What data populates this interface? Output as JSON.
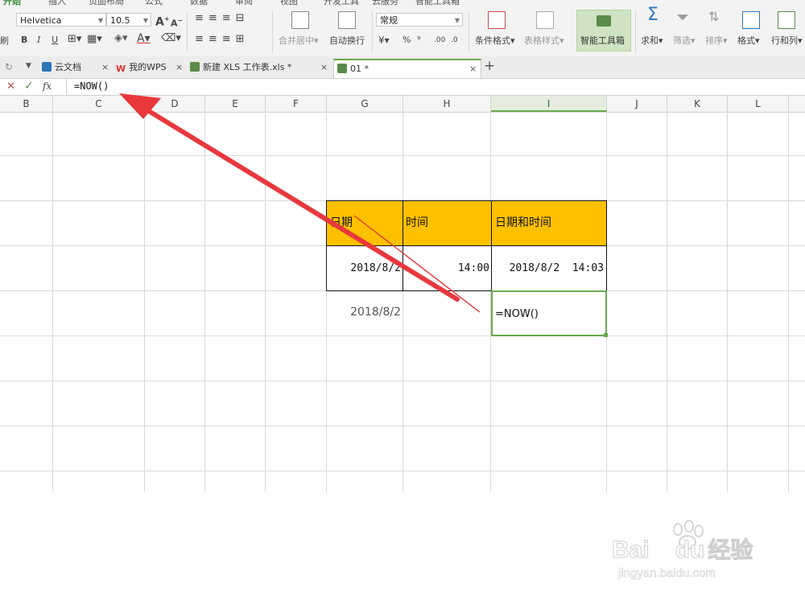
{
  "menu": {
    "tabs": [
      {
        "label": "开始",
        "active": true
      },
      {
        "label": "插入"
      },
      {
        "label": "页面布局"
      },
      {
        "label": "公式"
      },
      {
        "label": "数据"
      },
      {
        "label": "审阅"
      },
      {
        "label": "视图"
      },
      {
        "label": "开发工具"
      },
      {
        "label": "云服务"
      },
      {
        "label": "智能工具箱"
      }
    ]
  },
  "ribbon": {
    "left_stub": "刷",
    "font_name": "Helvetica",
    "font_size": "10.5",
    "grow_font": "A",
    "shrink_font": "A",
    "bold": "B",
    "italic": "I",
    "underline": "U",
    "font_color_glyph": "A",
    "merge_center": "合并居中",
    "wrap_text": "自动换行",
    "number_format": "常规",
    "percent": "%",
    "comma_style": "⁹",
    "increase_decimal": ".00",
    "decrease_decimal": ".0",
    "conditional_format": "条件格式",
    "table_style": "表格样式",
    "smart_toolbox": "智能工具箱",
    "sum": "求和",
    "filter": "筛选",
    "sort": "排序",
    "format": "格式",
    "rows_cols": "行和列"
  },
  "tabs": {
    "items": [
      {
        "label": "云文档"
      },
      {
        "label": "我的WPS"
      },
      {
        "label": "新建 XLS 工作表.xls *"
      },
      {
        "label": "01 *",
        "active": true
      }
    ],
    "new_tab": "+"
  },
  "formula_bar": {
    "cancel": "✕",
    "confirm": "✓",
    "fx": "fx",
    "value": "=NOW()"
  },
  "columns": [
    "B",
    "C",
    "D",
    "E",
    "F",
    "G",
    "H",
    "I",
    "J",
    "K",
    "L"
  ],
  "selected_column": "I",
  "table": {
    "headers": [
      "日期",
      "时间",
      "日期和时间"
    ],
    "row": [
      "2018/8/2",
      "14:00",
      "2018/8/2  14:03"
    ]
  },
  "below_table": {
    "date_result": "2018/8/2",
    "editing_formula": "=NOW()"
  },
  "watermark": {
    "brand": "Bai",
    "brand_suffix": "du",
    "chinese": "经验",
    "url": "jingyan.baidu.com"
  },
  "colors": {
    "header_fill": "#ffc000",
    "selection_green": "#6aa84f",
    "annotation_arrow": "#e8383d"
  }
}
